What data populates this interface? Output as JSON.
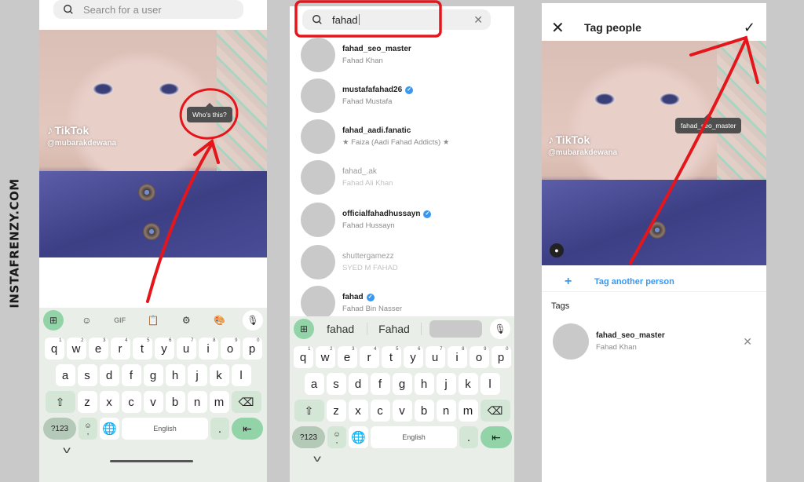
{
  "watermark": "INSTAFRENZY.COM",
  "colors": {
    "annotation_red": "#e4161b",
    "link_blue": "#3897f0",
    "keyboard_bg": "#e9efe8",
    "keyboard_accent": "#92d3a8"
  },
  "panel1": {
    "search_placeholder": "Search for a user",
    "tooltip": "Who's this?",
    "tiktok_brand": "TikTok",
    "tiktok_user": "@mubarakdewana",
    "keyboard": {
      "toolbar": [
        "apps-icon",
        "sticker-icon",
        "GIF",
        "clipboard-icon",
        "settings-icon",
        "palette-icon",
        "mic-icon"
      ],
      "gif_label": "GIF"
    }
  },
  "panel2": {
    "search_value": "fahad",
    "results": [
      {
        "username": "fahad_seo_master",
        "name": "Fahad Khan",
        "verified": false,
        "faded": false
      },
      {
        "username": "mustafafahad26",
        "name": "Fahad Mustafa",
        "verified": true,
        "faded": false
      },
      {
        "username": "fahad_aadi.fanatic",
        "name": "★ Faiza (Aadi Fahad Addicts) ★",
        "verified": false,
        "faded": false
      },
      {
        "username": "fahad_.ak",
        "name": "Fahad Ali Khan",
        "verified": false,
        "faded": true
      },
      {
        "username": "officialfahadhussayn",
        "name": "Fahad Hussayn",
        "verified": true,
        "faded": false
      },
      {
        "username": "shuttergamezz",
        "name": "SYED M FAHAD",
        "verified": false,
        "faded": true
      },
      {
        "username": "fahad",
        "name": "Fahad Bin Nasser",
        "verified": true,
        "faded": false
      }
    ],
    "suggestions": [
      "fahad",
      "Fahad"
    ]
  },
  "panel3": {
    "title": "Tag people",
    "tag_label": "fahad_seo_master",
    "tiktok_brand": "TikTok",
    "tiktok_user": "@mubarakdewana",
    "tag_another": "Tag another person",
    "tags_heading": "Tags",
    "tagged": {
      "username": "fahad_seo_master",
      "name": "Fahad Khan"
    }
  },
  "keyboard": {
    "row1": [
      [
        "q",
        "1"
      ],
      [
        "w",
        "2"
      ],
      [
        "e",
        "3"
      ],
      [
        "r",
        "4"
      ],
      [
        "t",
        "5"
      ],
      [
        "y",
        "6"
      ],
      [
        "u",
        "7"
      ],
      [
        "i",
        "8"
      ],
      [
        "o",
        "9"
      ],
      [
        "p",
        "0"
      ]
    ],
    "row2": [
      "a",
      "s",
      "d",
      "f",
      "g",
      "h",
      "j",
      "k",
      "l"
    ],
    "row3": [
      "z",
      "x",
      "c",
      "v",
      "b",
      "n",
      "m"
    ],
    "num_label": "?123",
    "space_label": "English",
    "dot_label": "."
  }
}
